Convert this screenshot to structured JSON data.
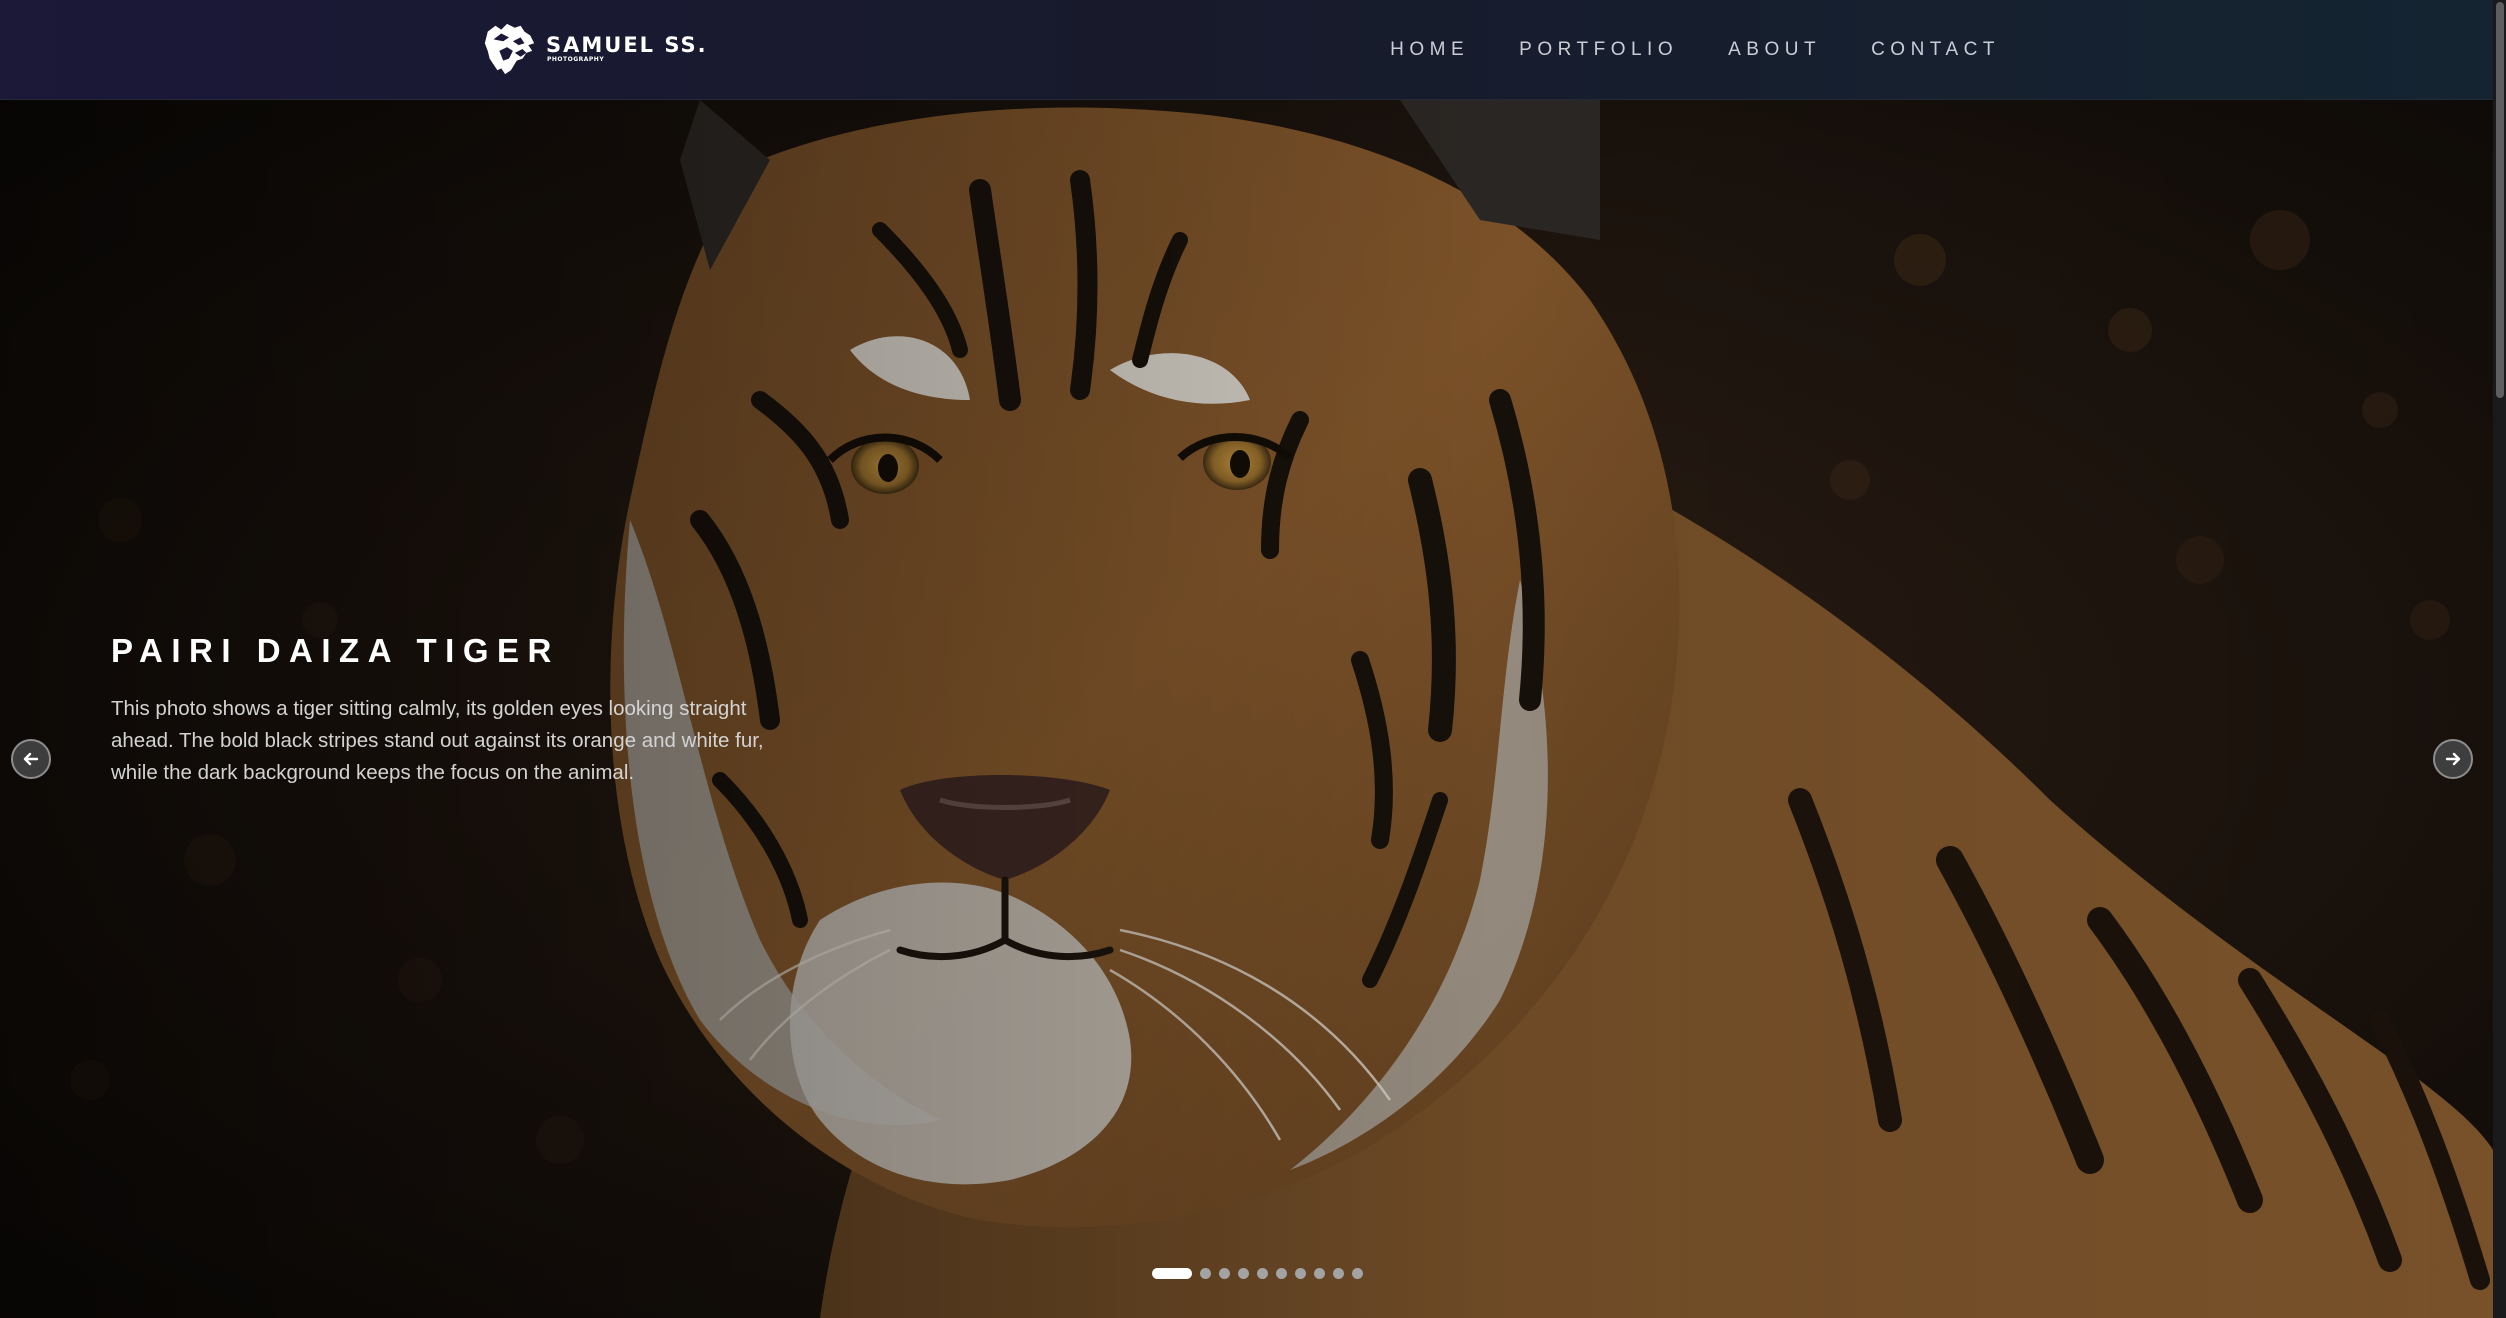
{
  "brand": {
    "name": "SAMUEL SS.",
    "subtitle": "PHOTOGRAPHY",
    "logo_icon": "wolf-head-icon"
  },
  "nav": {
    "items": [
      {
        "label": "HOME"
      },
      {
        "label": "PORTFOLIO"
      },
      {
        "label": "ABOUT"
      },
      {
        "label": "CONTACT"
      }
    ]
  },
  "slide": {
    "title": "PAIRI DAIZA TIGER",
    "description": "This photo shows a tiger sitting calmly, its golden eyes looking straight ahead. The bold black stripes stand out against its orange and white fur, while the dark background keeps the focus on the animal.",
    "photo_subject": "tiger"
  },
  "carousel": {
    "prev_icon": "arrow-left-icon",
    "next_icon": "arrow-right-icon",
    "slide_count": 10,
    "active_index": 0
  },
  "colors": {
    "navbar_start": "#1b1838",
    "navbar_end": "#142431",
    "nav_text": "#c9cdd6",
    "dot_active": "#ffffff",
    "dot_inactive": "#a3a3a3"
  }
}
